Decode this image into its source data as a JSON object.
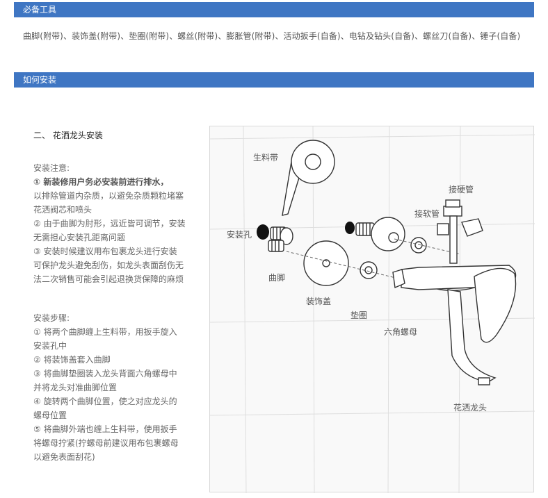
{
  "sections": {
    "tools_header": "必备工具",
    "install_header": "如何安装"
  },
  "tools_text": "曲脚(附带)、装饰盖(附带)、垫圈(附带)、螺丝(附带)、膨胀管(附带)、活动扳手(自备)、电钻及钻头(自备)、螺丝刀(自备)、锤子(自备)",
  "install": {
    "title": "二、 花洒龙头安装",
    "notes": [
      "安装注意:",
      "① 新装修用户务必安装前进行排水，",
      "以排除管道内杂质，以避免杂质颗粒堵塞",
      "花洒阀芯和喷头",
      "② 由于曲脚为肘形，远近皆可调节，安装",
      "无需担心安装孔距离问题",
      "③ 安装时候建议用布包裹龙头进行安装",
      "可保护龙头避免刮伤，如龙头表面刮伤无",
      "法二次销售可能会引起退换货保障的麻烦"
    ],
    "steps": [
      "安装步骤:",
      "① 将两个曲脚缠上生料带，用扳手旋入",
      "安装孔中",
      "② 将装饰盖套入曲脚",
      "③ 将曲脚垫圈装入龙头背面六角螺母中",
      "并将龙头对准曲脚位置",
      "④ 旋转两个曲脚位置，使之对应龙头的",
      "螺母位置",
      "⑤ 将曲脚外端也缠上生料带，使用扳手",
      "将螺母拧紧(拧螺母前建议用布包裹螺母",
      "以避免表面刮花)"
    ]
  },
  "diagram": {
    "labels": {
      "tape": "生料带",
      "hole": "安装孔",
      "elbow": "曲脚",
      "cover": "装饰盖",
      "washer": "垫圈",
      "hex_nut": "六角螺母",
      "faucet": "花洒龙头",
      "hard_pipe": "接硬管",
      "soft_pipe": "接软管"
    }
  }
}
